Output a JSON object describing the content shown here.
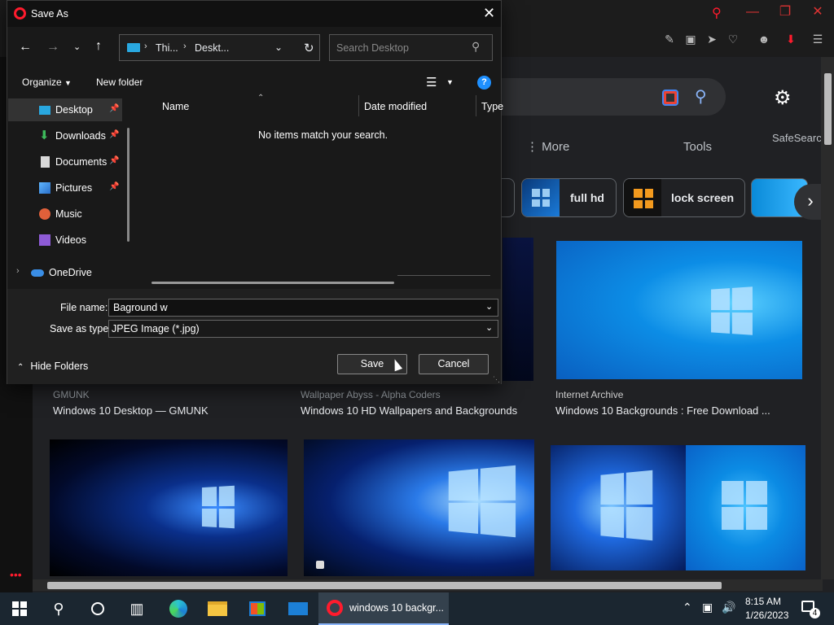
{
  "browser": {
    "search_nav": {
      "more": "⋮ More",
      "tools": "Tools",
      "safesearch": "SafeSearch"
    },
    "chips": [
      {
        "label": "full hd"
      },
      {
        "label": "lock screen"
      }
    ],
    "results_row1": [
      {
        "source": "GMUNK",
        "caption": "Windows 10 Desktop — GMUNK"
      },
      {
        "source": "Wallpaper Abyss - Alpha Coders",
        "caption": "Windows 10 HD Wallpapers and Backgrounds"
      },
      {
        "source": "Internet Archive",
        "caption": "Windows 10 Backgrounds : Free Download ..."
      }
    ],
    "accent": "#ff1b2d"
  },
  "dialog": {
    "title": "Save As",
    "breadcrumb": [
      "Thi...",
      "Deskt..."
    ],
    "search_placeholder": "Search Desktop",
    "organize": "Organize",
    "new_folder": "New folder",
    "nav_items": [
      {
        "label": "Desktop",
        "icon": "desktop-icon",
        "pinned": true
      },
      {
        "label": "Downloads",
        "icon": "download-icon",
        "pinned": true
      },
      {
        "label": "Documents",
        "icon": "documents-icon",
        "pinned": true
      },
      {
        "label": "Pictures",
        "icon": "pictures-icon",
        "pinned": true
      },
      {
        "label": "Music",
        "icon": "music-icon",
        "pinned": false
      },
      {
        "label": "Videos",
        "icon": "videos-icon",
        "pinned": false
      },
      {
        "label": "OneDrive",
        "icon": "cloud-icon",
        "pinned": false
      }
    ],
    "columns": [
      "Name",
      "Date modified",
      "Type"
    ],
    "empty_message": "No items match your search.",
    "file_name_label": "File name:",
    "file_name_value": "Baground w",
    "save_type_label": "Save as type:",
    "save_type_value": "JPEG Image (*.jpg)",
    "hide_folders": "Hide Folders",
    "save": "Save",
    "cancel": "Cancel"
  },
  "taskbar": {
    "active_app": "windows 10 backgr...",
    "time": "8:15 AM",
    "date": "1/26/2023",
    "notifications": "4"
  }
}
